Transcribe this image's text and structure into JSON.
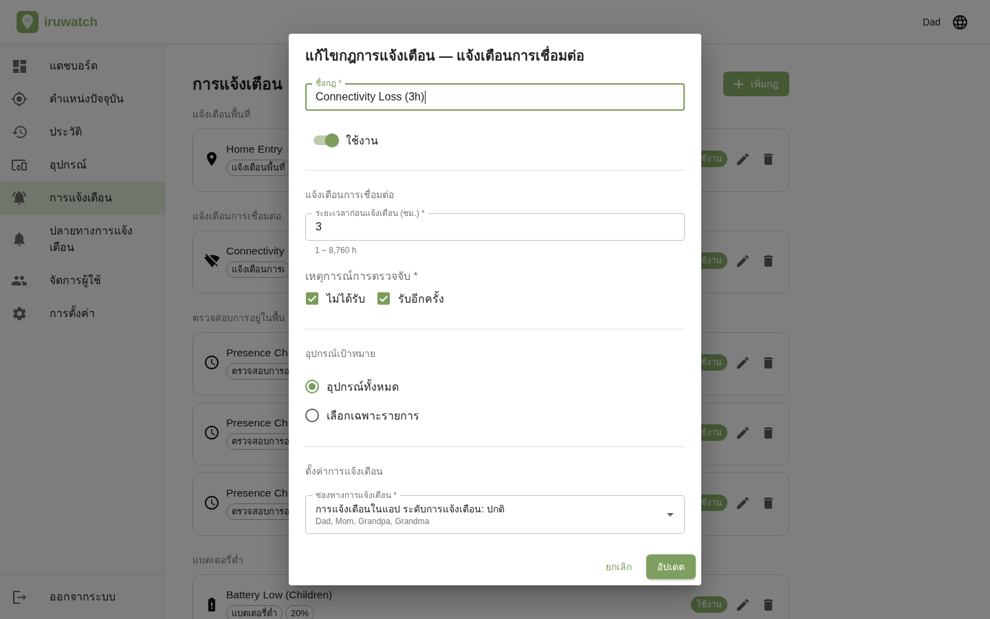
{
  "header": {
    "brand": "iruwatch",
    "user": "Dad"
  },
  "sidebar": {
    "items": [
      {
        "label": "แดชบอร์ด",
        "selected": false
      },
      {
        "label": "ตำแหน่งปัจจุบัน",
        "selected": false
      },
      {
        "label": "ประวัติ",
        "selected": false
      },
      {
        "label": "อุปกรณ์",
        "selected": false
      },
      {
        "label": "การแจ้งเตือน",
        "selected": true
      },
      {
        "label": "ปลายทางการแจ้งเตือน",
        "selected": false
      },
      {
        "label": "จัดการผู้ใช้",
        "selected": false
      },
      {
        "label": "การตั้งค่า",
        "selected": false
      }
    ],
    "logout": "ออกจากระบบ"
  },
  "page": {
    "title": "การแจ้งเตือน",
    "add_button": "เพิ่มกฎ",
    "sections": [
      {
        "label": "แจ้งเตือนพื้นที่",
        "kind": "area",
        "rules": [
          {
            "name": "Home Entry",
            "tags": [
              "แจ้งเตือนพื้นที่"
            ],
            "status": "ช้งาน"
          }
        ]
      },
      {
        "label": "แจ้งเตือนการเชื่อมต่อ",
        "kind": "connectivity",
        "rules": [
          {
            "name": "Connectivity",
            "tags": [
              "แจ้งเตือนการเ"
            ],
            "status": "ช้งาน"
          }
        ]
      },
      {
        "label": "ตรวจสอบการอยู่ในพื้น",
        "kind": "presence",
        "rules": [
          {
            "name": "Presence Ch",
            "tags": [
              "ตรวจสอบการอ"
            ],
            "status": "ช้งาน"
          },
          {
            "name": "Presence Ch",
            "tags": [
              "ตรวจสอบการอ"
            ],
            "status": "ช้งาน"
          },
          {
            "name": "Presence Ch",
            "tags": [
              "ตรวจสอบการอ"
            ],
            "status": "ช้งาน"
          }
        ]
      },
      {
        "label": "แบตเตอรี่ต่ำ",
        "kind": "battery",
        "rules": [
          {
            "name": "Battery Low (Children)",
            "tags": [
              "แบตเตอรี่ต่ำ",
              "20%"
            ],
            "status": "ใช้งาน"
          }
        ]
      }
    ]
  },
  "dialog": {
    "title": "แก้ไขกฎการแจ้งเตือน — แจ้งเตือนการเชื่อมต่อ",
    "name_field": {
      "label": "ชื่อกฎ *",
      "value": "Connectivity Loss (3h)",
      "focused": true
    },
    "active_toggle": {
      "label": "ใช้งาน",
      "on": true
    },
    "condition_heading": "แจ้งเตือนการเชื่อมต่อ",
    "delay_field": {
      "label": "ระยะเวลาก่อนแจ้งเตือน (ชม.) *",
      "value": "3",
      "helper": "1 ~ 8,760 h",
      "focused": false
    },
    "events_label": "เหตุการณ์การตรวจจับ *",
    "events": [
      {
        "label": "ไม่ได้รับ",
        "checked": true
      },
      {
        "label": "รับอีกครั้ง",
        "checked": true
      }
    ],
    "target_heading": "อุปกรณ์เป้าหมาย",
    "target_options": [
      {
        "label": "อุปกรณ์ทั้งหมด",
        "selected": true
      },
      {
        "label": "เลือกเฉพาะรายการ",
        "selected": false
      }
    ],
    "notify_heading": "ตั้งค่าการแจ้งเตือน",
    "channel_select": {
      "label": "ช่องทางการแจ้งเตือน *",
      "value": "การแจ้งเตือนในแอป ระดับการแจ้งเตือน: ปกติ",
      "recipients": "Dad, Mom, Grandpa, Grandma"
    },
    "buttons": [
      {
        "label": "ยกเลิก",
        "kind": "text"
      },
      {
        "label": "อัปเดต",
        "kind": "contained"
      }
    ]
  }
}
